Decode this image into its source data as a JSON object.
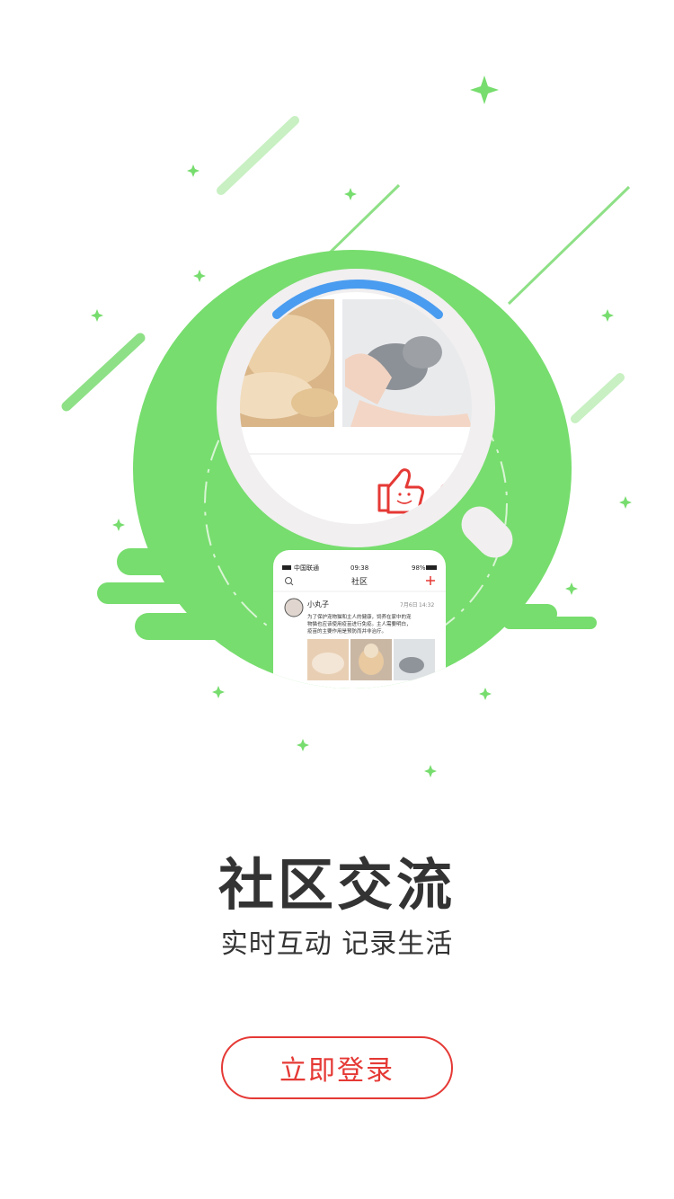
{
  "phone": {
    "carrier": "中国联通",
    "time": "09:38",
    "battery": "98%",
    "nav_title": "社区",
    "post": {
      "username": "小丸子",
      "date": "7月6日",
      "time": "14:32",
      "text_line1": "为了保护宠物猫和主人的健康，饲养在家中的宠",
      "text_line2": "物猫也应该使用疫苗进行免疫。主人需要明白，",
      "text_line3": "疫苗的主要作用是预防而并非治疗。"
    }
  },
  "title": "社区交流",
  "subtitle": "实时互动 记录生活",
  "login_button": "立即登录",
  "colors": {
    "green": "#77dd6e",
    "accent": "#e53935",
    "blue_arc": "#4a9cf0",
    "text": "#333333"
  },
  "icons": [
    "sparkle-icon",
    "magnifier-icon",
    "thumbs-up-icon",
    "search-icon",
    "plus-icon",
    "wifi-icon"
  ]
}
